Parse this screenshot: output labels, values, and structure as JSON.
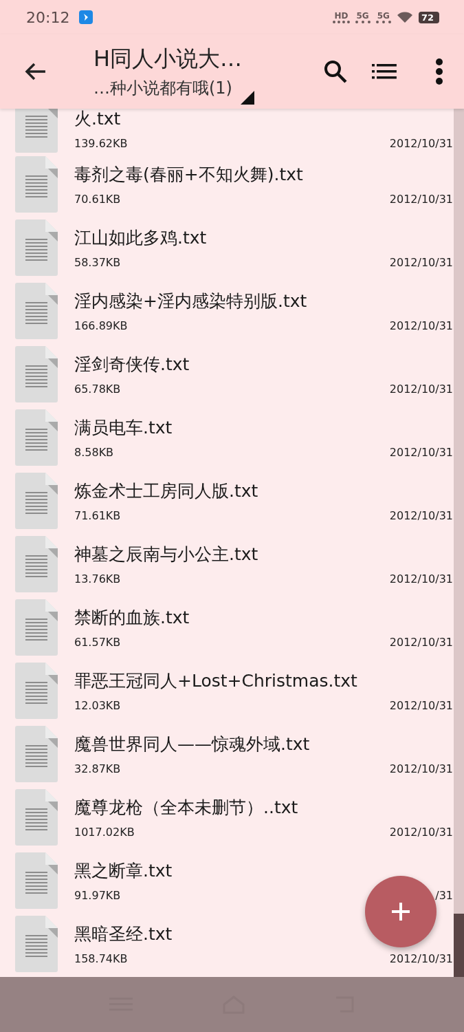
{
  "status_bar": {
    "time": "20:12",
    "network_labels": [
      "HD",
      "5G",
      "5G"
    ],
    "battery": "72"
  },
  "toolbar": {
    "title": "H同人小说大…",
    "subtitle": "…种小说都有哦(1)"
  },
  "files": [
    {
      "name": "火.txt",
      "size": "139.62KB",
      "date": "2012/10/31"
    },
    {
      "name": "毒剂之毒(春丽+不知火舞).txt",
      "size": "70.61KB",
      "date": "2012/10/31"
    },
    {
      "name": "江山如此多鸡.txt",
      "size": "58.37KB",
      "date": "2012/10/31"
    },
    {
      "name": "淫内感染+淫内感染特别版.txt",
      "size": "166.89KB",
      "date": "2012/10/31"
    },
    {
      "name": "淫剑奇侠传.txt",
      "size": "65.78KB",
      "date": "2012/10/31"
    },
    {
      "name": "满员电车.txt",
      "size": "8.58KB",
      "date": "2012/10/31"
    },
    {
      "name": "炼金术士工房同人版.txt",
      "size": "71.61KB",
      "date": "2012/10/31"
    },
    {
      "name": "神墓之辰南与小公主.txt",
      "size": "13.76KB",
      "date": "2012/10/31"
    },
    {
      "name": "禁断的血族.txt",
      "size": "61.57KB",
      "date": "2012/10/31"
    },
    {
      "name": "罪恶王冠同人+Lost+Christmas.txt",
      "size": "12.03KB",
      "date": "2012/10/31"
    },
    {
      "name": "魔兽世界同人——惊魂外域.txt",
      "size": "32.87KB",
      "date": "2012/10/31"
    },
    {
      "name": "魔尊龙枪（全本未删节）..txt",
      "size": "1017.02KB",
      "date": "2012/10/31"
    },
    {
      "name": "黑之断章.txt",
      "size": "91.97KB",
      "date": "/31"
    },
    {
      "name": "黑暗圣经.txt",
      "size": "158.74KB",
      "date": "2012/10/31"
    }
  ]
}
